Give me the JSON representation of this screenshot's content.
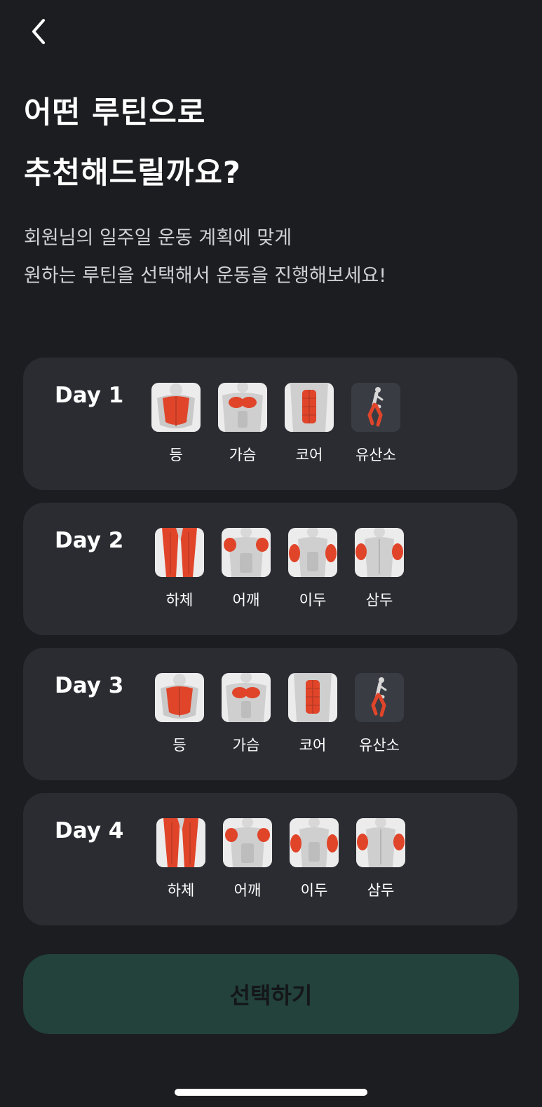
{
  "header": {
    "back_icon": "chevron-left-icon",
    "title_line1": "어떤 루틴으로",
    "title_line2": "추천해드릴까요?",
    "subtitle_line1": "회원님의 일주일 운동 계획에 맞게",
    "subtitle_line2": "원하는 루틴을 선택해서 운동을 진행해보세요!"
  },
  "routines": [
    {
      "day": "Day 1",
      "muscles": [
        {
          "label": "등",
          "icon": "back-muscle-icon"
        },
        {
          "label": "가슴",
          "icon": "chest-muscle-icon"
        },
        {
          "label": "코어",
          "icon": "core-muscle-icon"
        },
        {
          "label": "유산소",
          "icon": "cardio-runner-icon"
        }
      ]
    },
    {
      "day": "Day 2",
      "muscles": [
        {
          "label": "하체",
          "icon": "legs-muscle-icon"
        },
        {
          "label": "어깨",
          "icon": "shoulder-muscle-icon"
        },
        {
          "label": "이두",
          "icon": "biceps-muscle-icon"
        },
        {
          "label": "삼두",
          "icon": "triceps-muscle-icon"
        }
      ]
    },
    {
      "day": "Day 3",
      "muscles": [
        {
          "label": "등",
          "icon": "back-muscle-icon"
        },
        {
          "label": "가슴",
          "icon": "chest-muscle-icon"
        },
        {
          "label": "코어",
          "icon": "core-muscle-icon"
        },
        {
          "label": "유산소",
          "icon": "cardio-runner-icon"
        }
      ]
    },
    {
      "day": "Day 4",
      "muscles": [
        {
          "label": "하체",
          "icon": "legs-muscle-icon"
        },
        {
          "label": "어깨",
          "icon": "shoulder-muscle-icon"
        },
        {
          "label": "이두",
          "icon": "biceps-muscle-icon"
        },
        {
          "label": "삼두",
          "icon": "triceps-muscle-icon"
        }
      ]
    }
  ],
  "footer": {
    "select_label": "선택하기"
  },
  "colors": {
    "background": "#1c1d21",
    "card": "#2b2c32",
    "muscle_highlight": "#e0452a",
    "button": "#22423b",
    "button_text": "#141618"
  }
}
